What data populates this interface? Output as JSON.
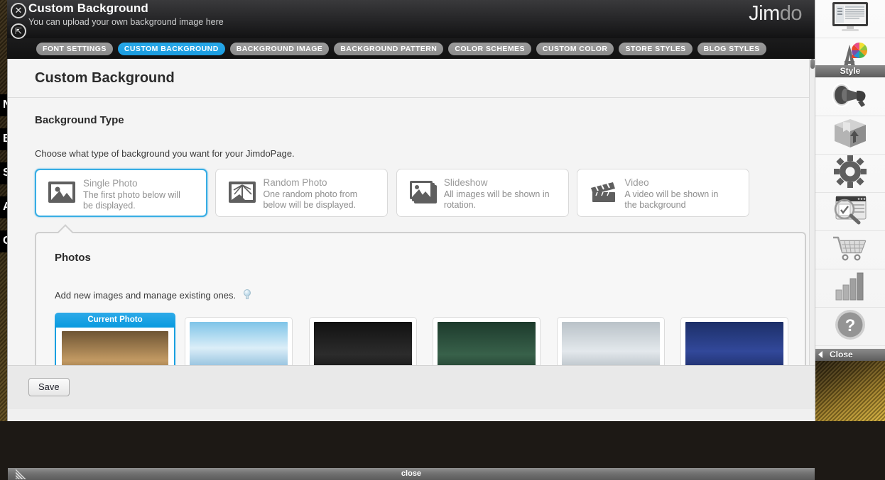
{
  "window": {
    "title": "Custom Background",
    "subtitle": "You can upload your own background image here",
    "logo_first": "Jim",
    "logo_second": "do",
    "close_icon": "close-circle-icon",
    "expand_icon": "expand-circle-icon",
    "bottom_close_label": "close"
  },
  "tabs": [
    {
      "label": "FONT SETTINGS",
      "active": false
    },
    {
      "label": "CUSTOM BACKGROUND",
      "active": true
    },
    {
      "label": "BACKGROUND IMAGE",
      "active": false
    },
    {
      "label": "BACKGROUND PATTERN",
      "active": false
    },
    {
      "label": "COLOR SCHEMES",
      "active": false
    },
    {
      "label": "CUSTOM COLOR",
      "active": false
    },
    {
      "label": "STORE STYLES",
      "active": false
    },
    {
      "label": "BLOG STYLES",
      "active": false
    }
  ],
  "content": {
    "page_title": "Custom Background",
    "section_title": "Background Type",
    "section_desc": "Choose what type of background you want for your JimdoPage.",
    "type_cards": [
      {
        "title": "Single Photo",
        "desc": "The first photo below will be displayed.",
        "icon": "single-photo-icon",
        "selected": true
      },
      {
        "title": "Random Photo",
        "desc": "One random photo from below will be displayed.",
        "icon": "random-photo-icon",
        "selected": false
      },
      {
        "title": "Slideshow",
        "desc": "All images will be shown in rotation.",
        "icon": "slideshow-icon",
        "selected": false
      },
      {
        "title": "Video",
        "desc": "A video will be shown in the background",
        "icon": "video-clapper-icon",
        "selected": false
      }
    ],
    "photos": {
      "title": "Photos",
      "desc": "Add new images and manage existing ones.",
      "hint_icon": "lightbulb-icon",
      "thumbnails": [
        {
          "badge": "Current Photo",
          "current": true,
          "colors": [
            "#6e5534",
            "#c39a63",
            "#3a2a16"
          ]
        },
        {
          "badge": "",
          "current": false,
          "colors": [
            "#7fc4e8",
            "#dbeef8",
            "#4a93c4"
          ]
        },
        {
          "badge": "",
          "current": false,
          "colors": [
            "#111111",
            "#2c2c2c",
            "#000000"
          ]
        },
        {
          "badge": "",
          "current": false,
          "colors": [
            "#1d3a2c",
            "#38614a",
            "#0f231a"
          ]
        },
        {
          "badge": "",
          "current": false,
          "colors": [
            "#b9c2c8",
            "#e3e8ec",
            "#8e9aa3"
          ]
        },
        {
          "badge": "",
          "current": false,
          "colors": [
            "#1c2f68",
            "#32489a",
            "#0d1940"
          ]
        }
      ]
    },
    "save_label": "Save"
  },
  "toolbar": {
    "items": [
      {
        "icon": "website-monitor-icon",
        "label": ""
      },
      {
        "icon": "style-palette-icon",
        "label": "Style"
      },
      {
        "icon": "megaphone-icon",
        "label": ""
      },
      {
        "icon": "package-box-icon",
        "label": ""
      },
      {
        "icon": "gear-icon",
        "label": ""
      },
      {
        "icon": "seo-magnifier-icon",
        "label": ""
      },
      {
        "icon": "shopping-cart-icon",
        "label": ""
      },
      {
        "icon": "statistics-bars-icon",
        "label": ""
      },
      {
        "icon": "help-question-icon",
        "label": ""
      }
    ],
    "close_label": "Close"
  },
  "background_site": {
    "nav_items": [
      "NO",
      "BL",
      "STO",
      "AB",
      "CO"
    ]
  },
  "colors": {
    "accent": "#1a9ce0",
    "tab_inactive": "#8f8f8f",
    "titlebar": "#242426",
    "panel": "#f4f4f4"
  }
}
